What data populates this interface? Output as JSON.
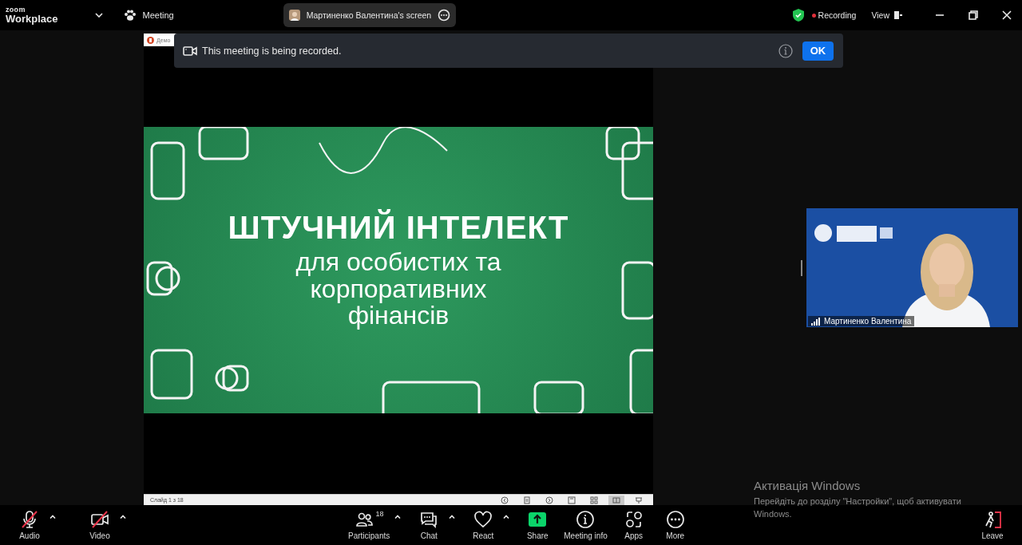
{
  "window": {
    "brand_top": "zoom",
    "brand": "Workplace",
    "meeting_label": "Meeting",
    "share_pill": "Мартиненко Валентина's screen",
    "recording": {
      "label": "Recording",
      "on": true
    },
    "view": "View"
  },
  "notice": {
    "text": "This meeting is being recorded.",
    "button": "OK"
  },
  "shared_screen": {
    "app_title": "Демо",
    "slide": {
      "title": "ШТУЧНИЙ ІНТЕЛЕКТ",
      "subtitle_lines": [
        "для особистих та",
        "корпоративних",
        "фінансів"
      ]
    },
    "status": "Слайд 1 з 18",
    "controls": [
      {
        "kind": "prev",
        "selected": false
      },
      {
        "kind": "notes",
        "selected": false
      },
      {
        "kind": "next",
        "selected": false
      },
      {
        "kind": "normal",
        "selected": false
      },
      {
        "kind": "sorter",
        "selected": false
      },
      {
        "kind": "reading",
        "selected": true
      },
      {
        "kind": "slideshow",
        "selected": false
      }
    ]
  },
  "participant_tile": {
    "name": "Мартиненко Валентина"
  },
  "watermark": {
    "title": "Активація Windows",
    "text": "Перейдіть до розділу \"Настройки\", щоб активувати Windows."
  },
  "toolbar": {
    "left": [
      {
        "kind": "audio",
        "label": "Audio",
        "muted": true,
        "caret": true
      },
      {
        "kind": "video",
        "label": "Video",
        "muted": true,
        "caret": true
      }
    ],
    "center": [
      {
        "kind": "participants",
        "label": "Participants",
        "count": "18",
        "caret": true
      },
      {
        "kind": "chat",
        "label": "Chat",
        "caret": true
      },
      {
        "kind": "react",
        "label": "React",
        "caret": true
      },
      {
        "kind": "share",
        "label": "Share",
        "caret": false
      },
      {
        "kind": "info",
        "label": "Meeting info",
        "caret": false
      },
      {
        "kind": "apps",
        "label": "Apps",
        "caret": false
      },
      {
        "kind": "more",
        "label": "More",
        "caret": false
      }
    ],
    "right": [
      {
        "kind": "leave",
        "label": "Leave",
        "caret": false
      }
    ]
  }
}
